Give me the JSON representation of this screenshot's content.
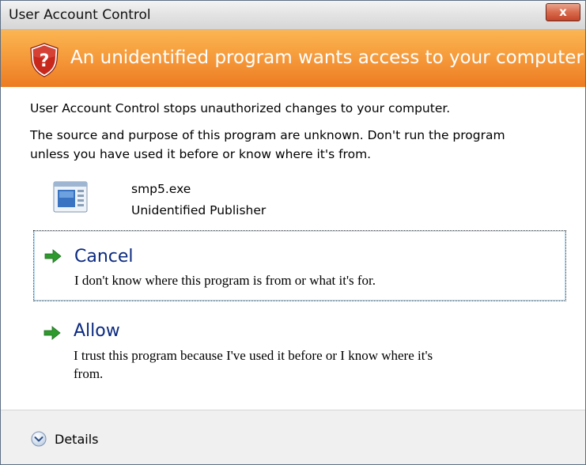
{
  "window": {
    "title": "User Account Control",
    "close_symbol": "x"
  },
  "banner": {
    "icon": "shield-question-icon",
    "text": "An unidentified program wants access to your computer"
  },
  "message": {
    "line1": "User Account Control stops unauthorized changes to your computer.",
    "line2": "The source and purpose of this program are unknown.  Don't run the program",
    "line3": "unless you have used it before or know where it's from."
  },
  "program": {
    "icon": "program-window-icon",
    "name": "smp5.exe",
    "publisher": "Unidentified Publisher"
  },
  "options": {
    "cancel": {
      "title": "Cancel",
      "description": "I don't know where this program is from or what it's for."
    },
    "allow": {
      "title": "Allow",
      "description_line1": "I trust this program because I've used it before or I know where it's",
      "description_line2": "from."
    }
  },
  "footer": {
    "details_label": "Details",
    "details_icon": "chevron-down-circle-icon"
  },
  "colors": {
    "banner": "#f5993a",
    "option_title": "#0b2a80",
    "arrow": "#2e9a2e"
  }
}
